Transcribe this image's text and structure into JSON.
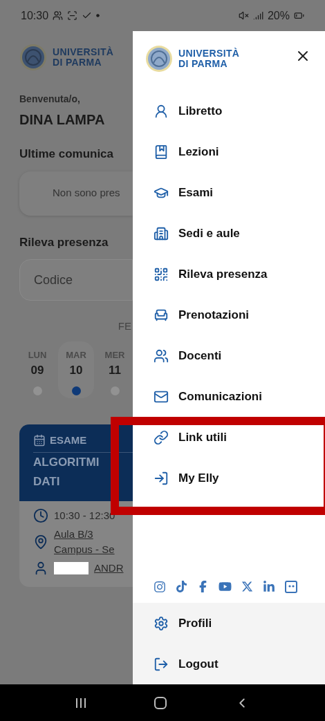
{
  "status_bar": {
    "time": "10:30",
    "battery": "20%"
  },
  "background": {
    "logo": {
      "line1": "UNIVERSITÀ",
      "line2": "DI PARMA"
    },
    "greeting": "Benvenuta/o,",
    "user_name": "DINA LAMPA",
    "announcements": {
      "title": "Ultime comunica",
      "empty_message": "Non sono pres"
    },
    "attendance": {
      "title": "Rileva presenza",
      "placeholder": "Codice"
    },
    "calendar": {
      "month": "FE",
      "days": [
        {
          "weekday": "LUN",
          "day": "09",
          "selected": false
        },
        {
          "weekday": "MAR",
          "day": "10",
          "selected": true
        },
        {
          "weekday": "MER",
          "day": "11",
          "selected": false
        }
      ]
    },
    "event": {
      "kind_label": "ESAME",
      "title_lines": [
        "ALGORITMI",
        "DATI"
      ],
      "time": "10:30 - 12:30",
      "room": "Aula B/3",
      "location": "Campus - Se",
      "teacher": "ANDR"
    }
  },
  "drawer": {
    "logo": {
      "line1": "UNIVERSITÀ",
      "line2": "DI PARMA"
    },
    "items": [
      {
        "label": "Libretto"
      },
      {
        "label": "Lezioni"
      },
      {
        "label": "Esami"
      },
      {
        "label": "Sedi e aule"
      },
      {
        "label": "Rileva presenza"
      },
      {
        "label": "Prenotazioni"
      },
      {
        "label": "Docenti"
      },
      {
        "label": "Comunicazioni"
      },
      {
        "label": "Link utili"
      },
      {
        "label": "My Elly"
      }
    ],
    "footer_items": [
      {
        "label": "Profili"
      },
      {
        "label": "Logout"
      }
    ]
  }
}
